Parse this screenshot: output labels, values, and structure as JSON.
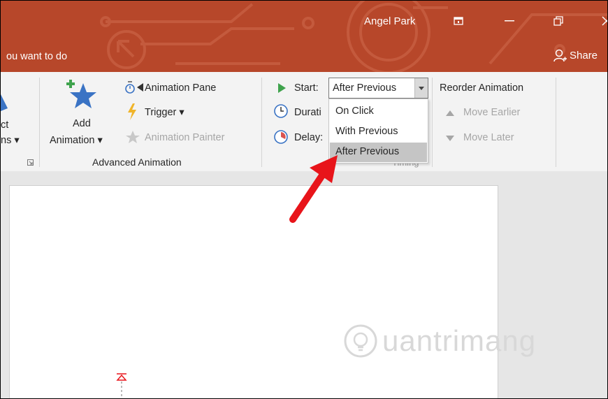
{
  "titlebar": {
    "user_name": "Angel Park",
    "tell_me": "ou want to do",
    "share_label": "Share"
  },
  "ribbon": {
    "partial_group": {
      "label_line1": "ct",
      "label_line2": "ns"
    },
    "advanced_animation": {
      "add_animation_line1": "Add",
      "add_animation_line2": "Animation",
      "animation_pane": "Animation Pane",
      "trigger": "Trigger",
      "animation_painter": "Animation Painter",
      "group_label": "Advanced Animation"
    },
    "timing": {
      "start_label": "Start:",
      "start_value": "After Previous",
      "duration_label": "Durati",
      "delay_label": "Delay:",
      "group_label_partial": "Timing"
    },
    "reorder": {
      "title": "Reorder Animation",
      "move_earlier": "Move Earlier",
      "move_later": "Move Later"
    }
  },
  "dropdown": {
    "options": [
      "On Click",
      "With Previous",
      "After Previous"
    ],
    "selected": "After Previous"
  },
  "watermark": "uantrimang",
  "colors": {
    "titlebar": "#b7472a",
    "ribbon": "#f3f3f3",
    "accent_arrow": "#e8141a"
  }
}
